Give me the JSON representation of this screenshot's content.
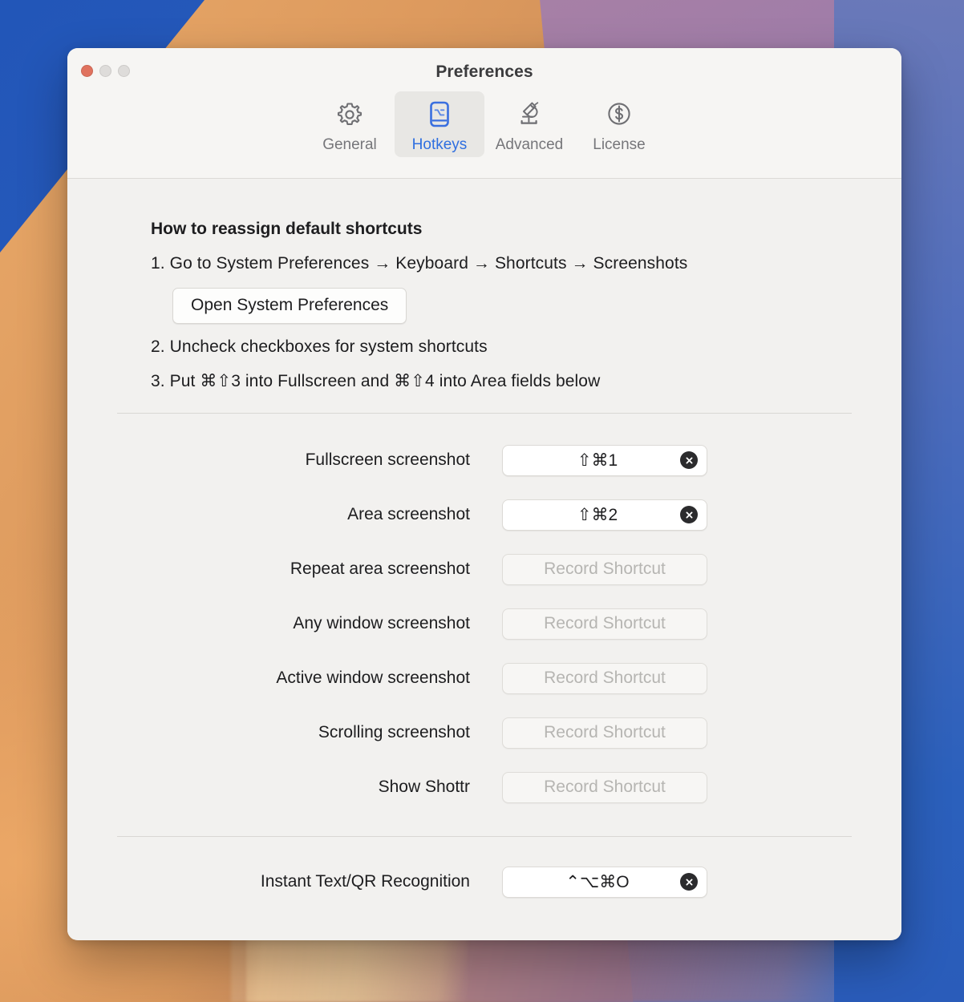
{
  "window": {
    "title": "Preferences",
    "traffic_lights": [
      {
        "name": "close",
        "color": "#e0725e"
      },
      {
        "name": "minimize",
        "color": "#dedcda"
      },
      {
        "name": "maximize",
        "color": "#dedcda"
      }
    ]
  },
  "toolbar": {
    "items": [
      {
        "label": "General",
        "icon": "gear-icon",
        "selected": false
      },
      {
        "label": "Hotkeys",
        "icon": "keyboard-key-icon",
        "selected": true
      },
      {
        "label": "Advanced",
        "icon": "microscope-icon",
        "selected": false
      },
      {
        "label": "License",
        "icon": "dollar-circle-icon",
        "selected": false
      }
    ],
    "accent_color": "#2f6fe0",
    "inactive_color": "#76767a"
  },
  "howto": {
    "title": "How to reassign default shortcuts",
    "step1": "1. Go to System Preferences → Keyboard → Shortcuts → Screenshots",
    "open_prefs_button": "Open System Preferences",
    "step2": "2. Uncheck checkboxes for system shortcuts",
    "step3": "3. Put ⌘⇧3 into Fullscreen and ⌘⇧4 into Area fields below"
  },
  "shortcuts": {
    "placeholder": "Record Shortcut",
    "rows": [
      {
        "label": "Fullscreen screenshot",
        "value": "⇧⌘1",
        "filled": true
      },
      {
        "label": "Area screenshot",
        "value": "⇧⌘2",
        "filled": true
      },
      {
        "label": "Repeat area screenshot",
        "value": "",
        "filled": false
      },
      {
        "label": "Any window screenshot",
        "value": "",
        "filled": false
      },
      {
        "label": "Active window screenshot",
        "value": "",
        "filled": false
      },
      {
        "label": "Scrolling screenshot",
        "value": "",
        "filled": false
      },
      {
        "label": "Show Shottr",
        "value": "",
        "filled": false
      }
    ],
    "bottom_rows": [
      {
        "label": "Instant Text/QR Recognition",
        "value": "⌃⌥⌘O",
        "filled": true
      }
    ]
  }
}
